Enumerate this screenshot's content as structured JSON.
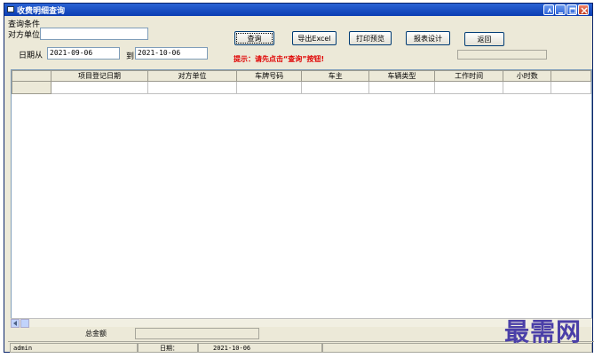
{
  "window": {
    "title": "收费明细查询"
  },
  "query": {
    "group_label": "查询条件",
    "party_label": "对方单位",
    "party_value": "",
    "date_from_label": "日期从",
    "date_from_value": "2021-09-06",
    "date_to_label": "到",
    "date_to_value": "2021-10-06",
    "hint": "提示：请先点击“查询”按钮!"
  },
  "toolbar": {
    "query_label": "查询",
    "export_label": "导出Excel",
    "print_preview_label": "打印预览",
    "report_design_label": "报表设计",
    "return_label": "返回"
  },
  "grid": {
    "columns": [
      "项目登记日期",
      "对方单位",
      "车牌号码",
      "车主",
      "车辆类型",
      "工作时间",
      "小时数"
    ]
  },
  "totals": {
    "label": "总金额"
  },
  "statusbar": {
    "user": "admin",
    "date_label": "日期：",
    "date_value": "2021-10-06"
  },
  "watermark": "最需网"
}
